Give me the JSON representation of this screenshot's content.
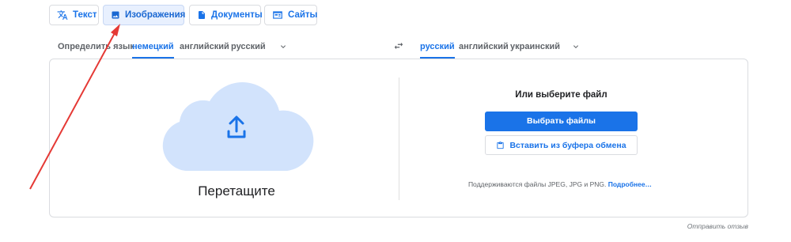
{
  "mode_tabs": [
    {
      "label": "Текст",
      "icon": "translate-icon"
    },
    {
      "label": "Изображения",
      "icon": "image-icon"
    },
    {
      "label": "Документы",
      "icon": "document-icon"
    },
    {
      "label": "Сайты",
      "icon": "website-icon"
    }
  ],
  "active_mode": "Изображения",
  "source_languages": [
    "Определить язык",
    "немецкий",
    "английский",
    "русский"
  ],
  "source_active": "немецкий",
  "target_languages": [
    "русский",
    "английский",
    "украинский"
  ],
  "target_active": "русский",
  "upload": {
    "drop_label": "Перетащите",
    "or_label": "Или выберите файл",
    "choose_button": "Выбрать файлы",
    "paste_button": "Вставить из буфера обмена",
    "support_text": "Поддерживаются файлы JPEG, JPG и PNG.",
    "more_link": "Подробнее…"
  },
  "feedback": "Отправить отзыв",
  "colors": {
    "accent": "#1a73e8",
    "cloud": "#d2e3fc",
    "annotation_arrow": "#e53935"
  }
}
